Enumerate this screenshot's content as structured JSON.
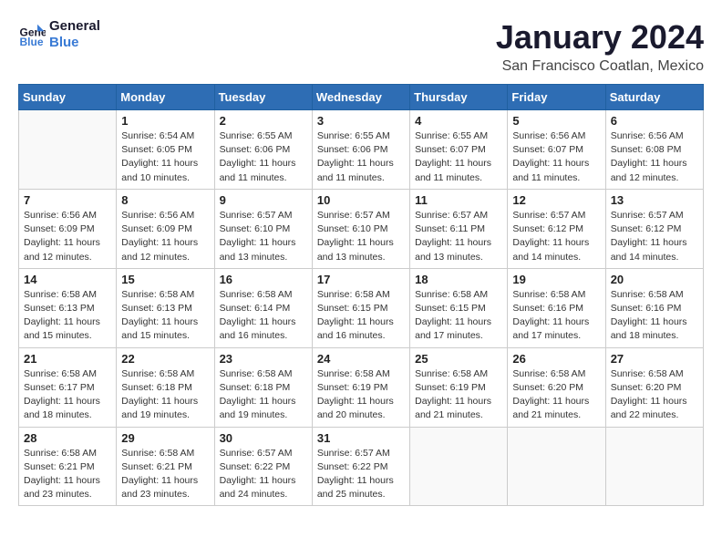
{
  "logo": {
    "line1": "General",
    "line2": "Blue"
  },
  "title": "January 2024",
  "subtitle": "San Francisco Coatlan, Mexico",
  "days_of_week": [
    "Sunday",
    "Monday",
    "Tuesday",
    "Wednesday",
    "Thursday",
    "Friday",
    "Saturday"
  ],
  "weeks": [
    [
      {
        "day": "",
        "info": ""
      },
      {
        "day": "1",
        "info": "Sunrise: 6:54 AM\nSunset: 6:05 PM\nDaylight: 11 hours\nand 10 minutes."
      },
      {
        "day": "2",
        "info": "Sunrise: 6:55 AM\nSunset: 6:06 PM\nDaylight: 11 hours\nand 11 minutes."
      },
      {
        "day": "3",
        "info": "Sunrise: 6:55 AM\nSunset: 6:06 PM\nDaylight: 11 hours\nand 11 minutes."
      },
      {
        "day": "4",
        "info": "Sunrise: 6:55 AM\nSunset: 6:07 PM\nDaylight: 11 hours\nand 11 minutes."
      },
      {
        "day": "5",
        "info": "Sunrise: 6:56 AM\nSunset: 6:07 PM\nDaylight: 11 hours\nand 11 minutes."
      },
      {
        "day": "6",
        "info": "Sunrise: 6:56 AM\nSunset: 6:08 PM\nDaylight: 11 hours\nand 12 minutes."
      }
    ],
    [
      {
        "day": "7",
        "info": "Sunrise: 6:56 AM\nSunset: 6:09 PM\nDaylight: 11 hours\nand 12 minutes."
      },
      {
        "day": "8",
        "info": "Sunrise: 6:56 AM\nSunset: 6:09 PM\nDaylight: 11 hours\nand 12 minutes."
      },
      {
        "day": "9",
        "info": "Sunrise: 6:57 AM\nSunset: 6:10 PM\nDaylight: 11 hours\nand 13 minutes."
      },
      {
        "day": "10",
        "info": "Sunrise: 6:57 AM\nSunset: 6:10 PM\nDaylight: 11 hours\nand 13 minutes."
      },
      {
        "day": "11",
        "info": "Sunrise: 6:57 AM\nSunset: 6:11 PM\nDaylight: 11 hours\nand 13 minutes."
      },
      {
        "day": "12",
        "info": "Sunrise: 6:57 AM\nSunset: 6:12 PM\nDaylight: 11 hours\nand 14 minutes."
      },
      {
        "day": "13",
        "info": "Sunrise: 6:57 AM\nSunset: 6:12 PM\nDaylight: 11 hours\nand 14 minutes."
      }
    ],
    [
      {
        "day": "14",
        "info": "Sunrise: 6:58 AM\nSunset: 6:13 PM\nDaylight: 11 hours\nand 15 minutes."
      },
      {
        "day": "15",
        "info": "Sunrise: 6:58 AM\nSunset: 6:13 PM\nDaylight: 11 hours\nand 15 minutes."
      },
      {
        "day": "16",
        "info": "Sunrise: 6:58 AM\nSunset: 6:14 PM\nDaylight: 11 hours\nand 16 minutes."
      },
      {
        "day": "17",
        "info": "Sunrise: 6:58 AM\nSunset: 6:15 PM\nDaylight: 11 hours\nand 16 minutes."
      },
      {
        "day": "18",
        "info": "Sunrise: 6:58 AM\nSunset: 6:15 PM\nDaylight: 11 hours\nand 17 minutes."
      },
      {
        "day": "19",
        "info": "Sunrise: 6:58 AM\nSunset: 6:16 PM\nDaylight: 11 hours\nand 17 minutes."
      },
      {
        "day": "20",
        "info": "Sunrise: 6:58 AM\nSunset: 6:16 PM\nDaylight: 11 hours\nand 18 minutes."
      }
    ],
    [
      {
        "day": "21",
        "info": "Sunrise: 6:58 AM\nSunset: 6:17 PM\nDaylight: 11 hours\nand 18 minutes."
      },
      {
        "day": "22",
        "info": "Sunrise: 6:58 AM\nSunset: 6:18 PM\nDaylight: 11 hours\nand 19 minutes."
      },
      {
        "day": "23",
        "info": "Sunrise: 6:58 AM\nSunset: 6:18 PM\nDaylight: 11 hours\nand 19 minutes."
      },
      {
        "day": "24",
        "info": "Sunrise: 6:58 AM\nSunset: 6:19 PM\nDaylight: 11 hours\nand 20 minutes."
      },
      {
        "day": "25",
        "info": "Sunrise: 6:58 AM\nSunset: 6:19 PM\nDaylight: 11 hours\nand 21 minutes."
      },
      {
        "day": "26",
        "info": "Sunrise: 6:58 AM\nSunset: 6:20 PM\nDaylight: 11 hours\nand 21 minutes."
      },
      {
        "day": "27",
        "info": "Sunrise: 6:58 AM\nSunset: 6:20 PM\nDaylight: 11 hours\nand 22 minutes."
      }
    ],
    [
      {
        "day": "28",
        "info": "Sunrise: 6:58 AM\nSunset: 6:21 PM\nDaylight: 11 hours\nand 23 minutes."
      },
      {
        "day": "29",
        "info": "Sunrise: 6:58 AM\nSunset: 6:21 PM\nDaylight: 11 hours\nand 23 minutes."
      },
      {
        "day": "30",
        "info": "Sunrise: 6:57 AM\nSunset: 6:22 PM\nDaylight: 11 hours\nand 24 minutes."
      },
      {
        "day": "31",
        "info": "Sunrise: 6:57 AM\nSunset: 6:22 PM\nDaylight: 11 hours\nand 25 minutes."
      },
      {
        "day": "",
        "info": ""
      },
      {
        "day": "",
        "info": ""
      },
      {
        "day": "",
        "info": ""
      }
    ]
  ]
}
